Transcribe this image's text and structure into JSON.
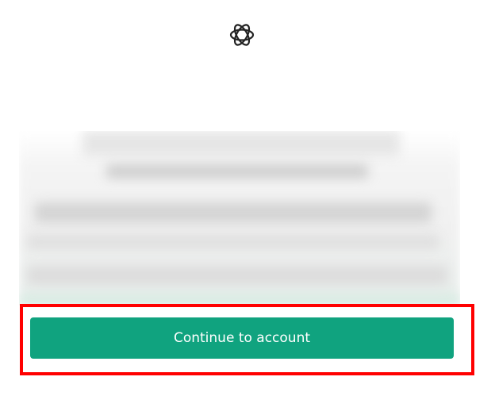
{
  "header": {
    "logo_icon": "openai-logo-icon"
  },
  "main": {
    "continue_label": "Continue to account"
  },
  "colors": {
    "accent": "#10a37f",
    "highlight": "#ff0000"
  }
}
